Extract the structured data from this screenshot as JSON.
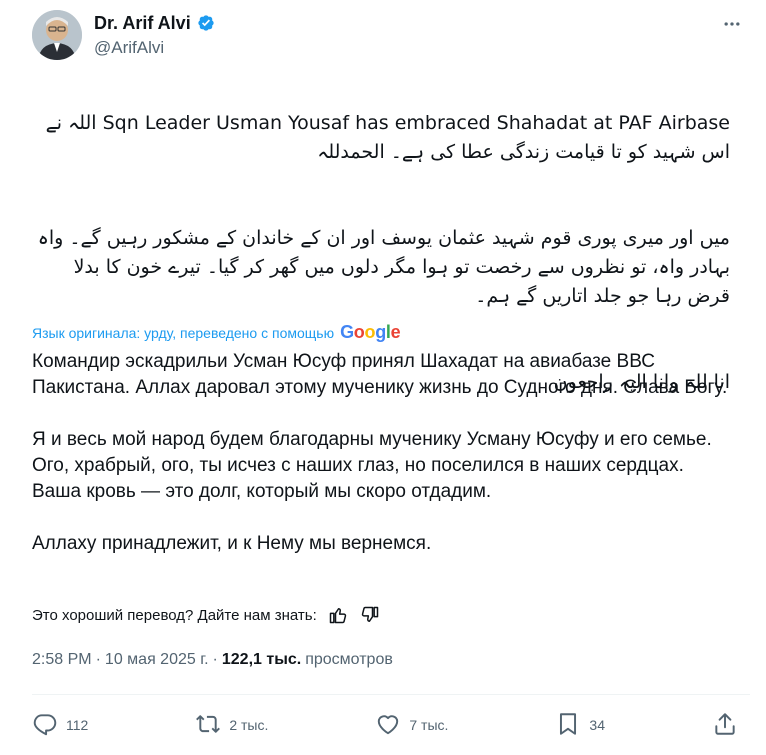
{
  "author": {
    "display_name": "Dr. Arif Alvi",
    "handle": "@ArifAlvi"
  },
  "post": {
    "urdu_paragraphs": [
      "Sqn Leader Usman Yousaf has embraced Shahadat at PAF Airbase اللہ نے اس شہید کو تا قیامت زندگی عطا کی ہے۔ الحمدللہ",
      "میں اور میری پوری قوم شہید عثمان یوسف اور ان کے خاندان کے مشکور رہیں گے۔ واہ بہادر واہ، تو نظروں سے رخصت تو ہوا مگر دلوں میں گھر کر گیا۔ تیرے خون کا بدلا قرض رہا جو جلد اتاریں گے ہم۔",
      "انا للہ وانا الیہ راجعون"
    ],
    "translation_note": "Язык оригинала: урду, переведено с помощью",
    "translation_provider": "Google",
    "translated_paragraphs": [
      "Командир эскадрильи Усман Юсуф принял Шахадат на авиабазе ВВС Пакистана. Аллах даровал этому мученику жизнь до Судного дня. Слава Богу.",
      "Я и весь мой народ будем благодарны мученику Усману Юсуфу и его семье. Ого, храбрый, ого, ты исчез с наших глаз, но поселился в наших сердцах. Ваша кровь — это долг, который мы скоро отдадим.",
      "Аллаху принадлежит, и к Нему мы вернемся."
    ],
    "feedback_prompt": "Это хороший перевод? Дайте нам знать:",
    "time": "2:58 PM",
    "date": "10 мая 2025 г.",
    "views_count": "122,1 тыс.",
    "views_label": "просмотров"
  },
  "actions": {
    "replies": "112",
    "reposts": "2 тыс.",
    "likes": "7 тыс.",
    "bookmarks": "34"
  },
  "colors": {
    "accent": "#1d9bf0",
    "secondary_text": "#536471",
    "primary_text": "#0f1419"
  },
  "icons": [
    "verified-badge-icon",
    "more-icon",
    "thumbs-up-icon",
    "thumbs-down-icon",
    "reply-icon",
    "repost-icon",
    "like-icon",
    "bookmark-icon",
    "share-icon"
  ]
}
